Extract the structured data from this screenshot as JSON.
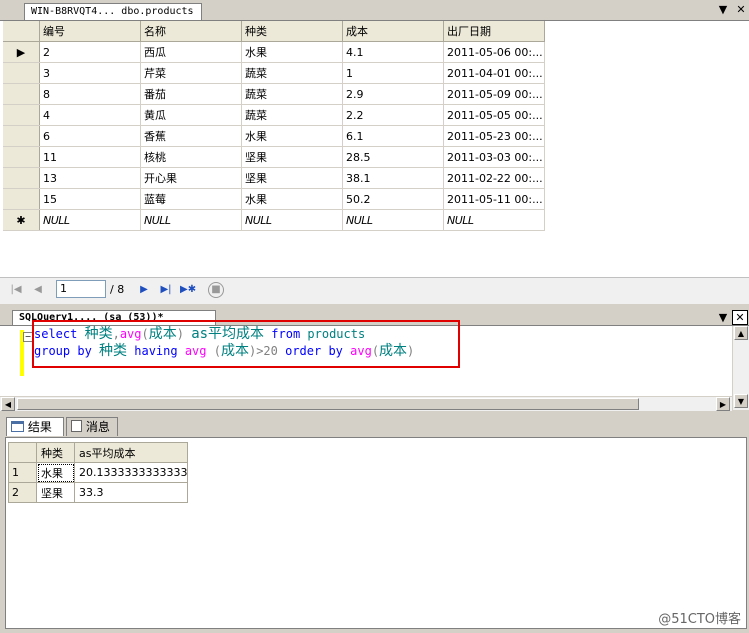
{
  "doc_tab": {
    "title": "WIN-B8RVQT4... dbo.products"
  },
  "grid": {
    "columns": [
      "编号",
      "名称",
      "种类",
      "成本",
      "出厂日期"
    ],
    "rows": [
      [
        "2",
        "西瓜",
        "水果",
        "4.1",
        "2011-05-06 00:..."
      ],
      [
        "3",
        "芹菜",
        "蔬菜",
        "1",
        "2011-04-01 00:..."
      ],
      [
        "8",
        "番茄",
        "蔬菜",
        "2.9",
        "2011-05-09 00:..."
      ],
      [
        "4",
        "黄瓜",
        "蔬菜",
        "2.2",
        "2011-05-05 00:..."
      ],
      [
        "6",
        "香蕉",
        "水果",
        "6.1",
        "2011-05-23 00:..."
      ],
      [
        "11",
        "核桃",
        "坚果",
        "28.5",
        "2011-03-03 00:..."
      ],
      [
        "13",
        "开心果",
        "坚果",
        "38.1",
        "2011-02-22 00:..."
      ],
      [
        "15",
        "蓝莓",
        "水果",
        "50.2",
        "2011-05-11 00:..."
      ],
      [
        "NULL",
        "NULL",
        "NULL",
        "NULL",
        "NULL"
      ]
    ],
    "new_row_marker": "✱",
    "current_row_marker": "▶"
  },
  "nav": {
    "position": "1",
    "total": "/ 8"
  },
  "query_tab": {
    "title": "SQLQuery1.... (sa (53))*"
  },
  "sql": {
    "line1": [
      "select ",
      "种类",
      ",",
      "avg",
      "(",
      "成本",
      ") ",
      "as平均成本",
      " from ",
      "products"
    ],
    "line2": [
      "group by ",
      "种类",
      " having ",
      "avg ",
      "(",
      "成本",
      ")>20 ",
      "order by ",
      "avg",
      "(",
      "成本",
      ")"
    ]
  },
  "results_tabs": {
    "results": "结果",
    "messages": "消息"
  },
  "results": {
    "columns": [
      "种类",
      "as平均成本"
    ],
    "rows": [
      [
        "1",
        "水果",
        "20.1333333333333"
      ],
      [
        "2",
        "坚果",
        "33.3"
      ]
    ]
  },
  "watermark": "@51CTO博客",
  "colors": {
    "highlight": "#e00000",
    "keyword": "#0000ff",
    "function": "#ff00ff"
  }
}
